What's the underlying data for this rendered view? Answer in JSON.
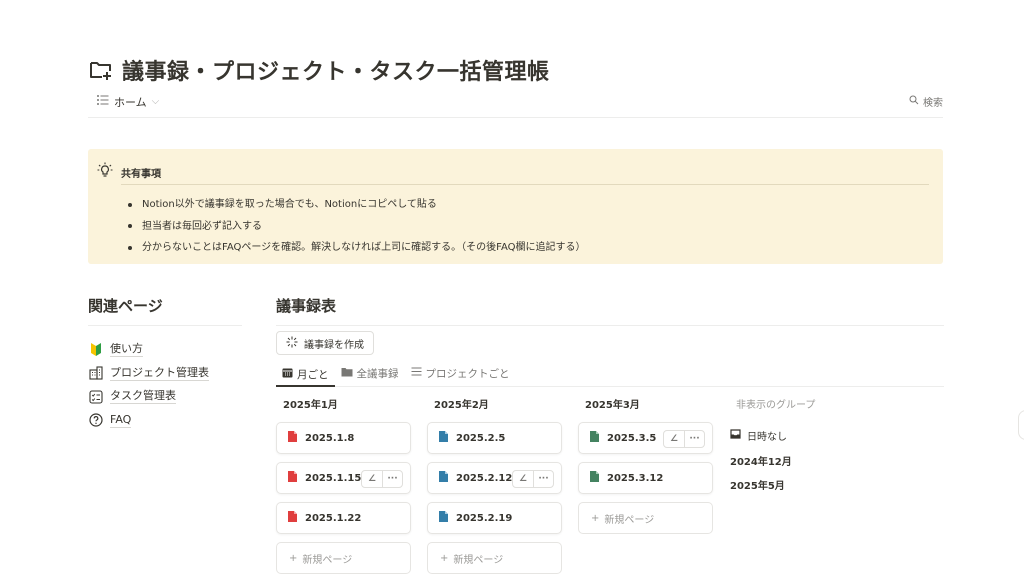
{
  "page": {
    "title": "議事録・プロジェクト・タスク一括管理帳"
  },
  "view": {
    "current": "ホーム",
    "search_label": "検索"
  },
  "callout": {
    "title": "共有事項",
    "items": [
      "Notion以外で議事録を取った場合でも、Notionにコピペして貼る",
      "担当者は毎回必ず記入する",
      "分からないことはFAQページを確認。解決しなければ上司に確認する。（その後FAQ欄に追記する）"
    ]
  },
  "related": {
    "title": "関連ページ",
    "items": [
      {
        "label": "使い方",
        "icon": "beginner-mark-icon"
      },
      {
        "label": "プロジェクト管理表",
        "icon": "building-icon"
      },
      {
        "label": "タスク管理表",
        "icon": "checklist-icon"
      },
      {
        "label": "FAQ",
        "icon": "question-circle-icon"
      }
    ]
  },
  "database": {
    "title": "議事録表",
    "create_label": "議事録を作成",
    "tabs": [
      {
        "label": "月ごと",
        "icon": "calendar-icon",
        "active": true
      },
      {
        "label": "全議事録",
        "icon": "folder-icon",
        "active": false
      },
      {
        "label": "プロジェクトごと",
        "icon": "list-icon",
        "active": false
      }
    ],
    "columns": [
      {
        "title": "2025年1月",
        "cards": [
          "2025.1.8",
          "2025.1.15",
          "2025.1.22"
        ],
        "doc_color": "#e03e3e"
      },
      {
        "title": "2025年2月",
        "cards": [
          "2025.2.5",
          "2025.2.12",
          "2025.2.19"
        ],
        "doc_color": "#337ea9"
      },
      {
        "title": "2025年3月",
        "cards": [
          "2025.3.5",
          "2025.3.12"
        ],
        "doc_color": "#448361"
      }
    ],
    "new_page_label": "新規ページ",
    "hidden_groups": {
      "title": "非表示のグループ",
      "items": [
        "日時なし",
        "2024年12月",
        "2025年5月"
      ]
    }
  }
}
